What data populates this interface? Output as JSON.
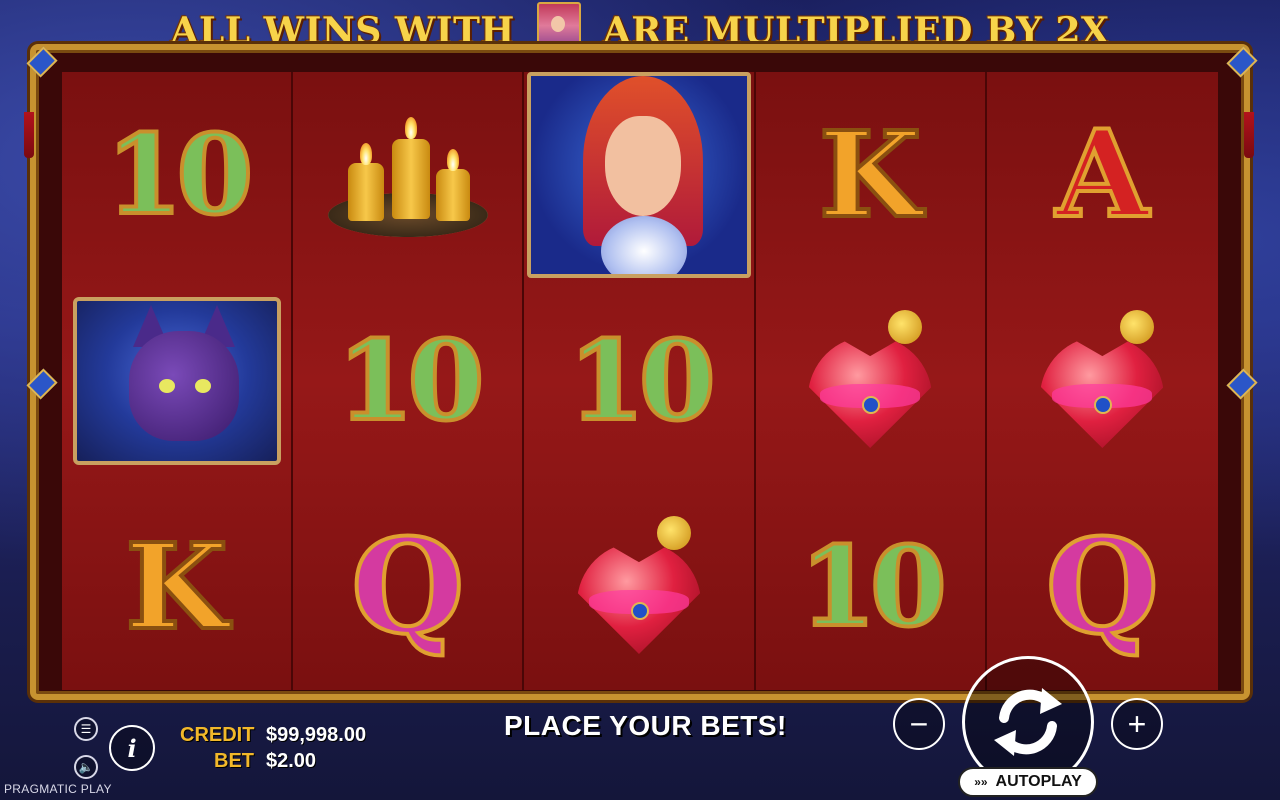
{
  "banner": {
    "text_before": "ALL WINS WITH",
    "text_after": "ARE MULTIPLIED BY 2X",
    "icon": "gypsy-woman-icon"
  },
  "reels": [
    [
      "10",
      "cat",
      "K"
    ],
    [
      "candles",
      "10",
      "Q"
    ],
    [
      "gypsy",
      "10",
      "potion"
    ],
    [
      "K",
      "potion",
      "10"
    ],
    [
      "A",
      "potion",
      "Q"
    ]
  ],
  "controls": {
    "menu_icon": "menu-icon",
    "info_label": "i",
    "sound_icon": "sound-icon",
    "credit_label": "CREDIT",
    "credit_value": "$99,998.00",
    "bet_label": "BET",
    "bet_value": "$2.00",
    "message": "PLACE YOUR BETS!",
    "minus_label": "−",
    "plus_label": "+",
    "spin_icon": "spin-icon",
    "autoplay_label": "AUTOPLAY",
    "brand": "PRAGMATIC PLAY"
  },
  "colors": {
    "gold": "#f2b82a",
    "reel_red": "#961818",
    "frame_gold": "#c79330"
  }
}
